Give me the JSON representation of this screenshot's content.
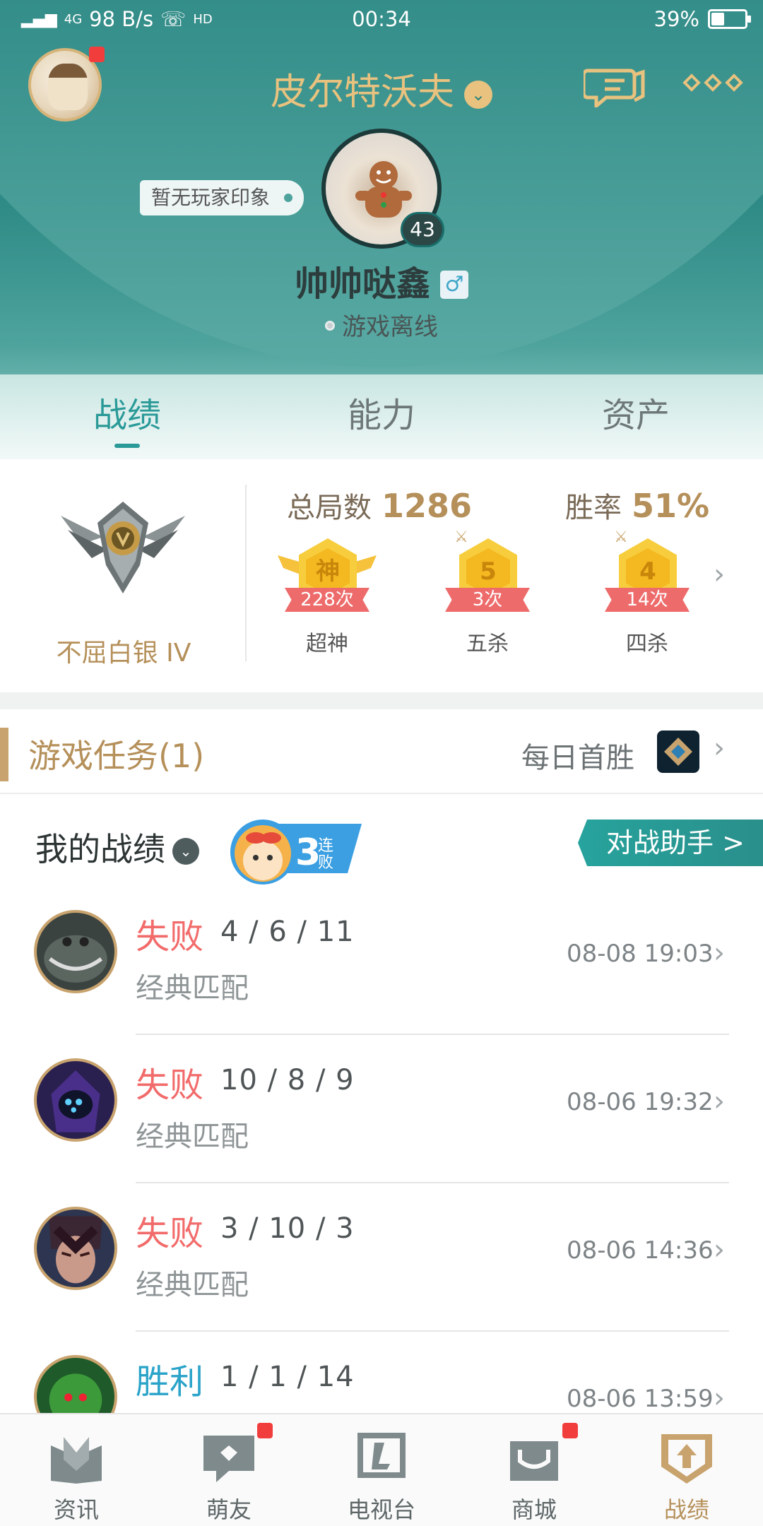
{
  "status_bar": {
    "network": "4G",
    "speed": "98 B/s",
    "call": "HD",
    "time": "00:34",
    "battery": "39%",
    "battery_level": 0.39
  },
  "header": {
    "account_name": "皮尔特沃夫",
    "impression": "暂无玩家印象",
    "level": "43",
    "nickname": "帅帅哒鑫",
    "gender_symbol": "♂",
    "status": "游戏离线"
  },
  "tabs": [
    {
      "label": "战绩",
      "active": true
    },
    {
      "label": "能力",
      "active": false
    },
    {
      "label": "资产",
      "active": false
    }
  ],
  "stats": {
    "rank": "不屈白银 IV",
    "total_games_label": "总局数",
    "total_games": "1286",
    "winrate_label": "胜率",
    "winrate": "51%",
    "medals": [
      {
        "glyph": "神",
        "count": "228次",
        "label": "超神"
      },
      {
        "glyph": "5",
        "count": "3次",
        "label": "五杀"
      },
      {
        "glyph": "4",
        "count": "14次",
        "label": "四杀"
      }
    ]
  },
  "tasks": {
    "title": "游戏任务(1)",
    "daily": "每日首胜"
  },
  "records": {
    "title": "我的战绩",
    "streak_number": "3",
    "streak_text": "连败",
    "helper_button": "对战助手 >"
  },
  "matches": [
    {
      "result": "失败",
      "kda": "4 / 6 / 11",
      "mode": "经典匹配",
      "time": "08-08 19:03",
      "type": "lose"
    },
    {
      "result": "失败",
      "kda": "10 / 8 / 9",
      "mode": "经典匹配",
      "time": "08-06 19:32",
      "type": "lose"
    },
    {
      "result": "失败",
      "kda": "3 / 10 / 3",
      "mode": "经典匹配",
      "time": "08-06 14:36",
      "type": "lose"
    },
    {
      "result": "胜利",
      "kda": "1 / 1 / 14",
      "mode": "",
      "time": "08-06 13:59",
      "type": "win"
    }
  ],
  "bottom_nav": [
    {
      "label": "资讯",
      "icon": "news-icon",
      "active": false,
      "badge": false
    },
    {
      "label": "萌友",
      "icon": "friends-icon",
      "active": false,
      "badge": true
    },
    {
      "label": "电视台",
      "icon": "tv-icon",
      "active": false,
      "badge": false
    },
    {
      "label": "商城",
      "icon": "shop-icon",
      "active": false,
      "badge": true
    },
    {
      "label": "战绩",
      "icon": "record-icon",
      "active": true,
      "badge": false
    }
  ],
  "colors": {
    "teal": "#2a9a98",
    "gold": "#b5905a",
    "lose": "#f26b6b",
    "win": "#2aa3c9"
  }
}
